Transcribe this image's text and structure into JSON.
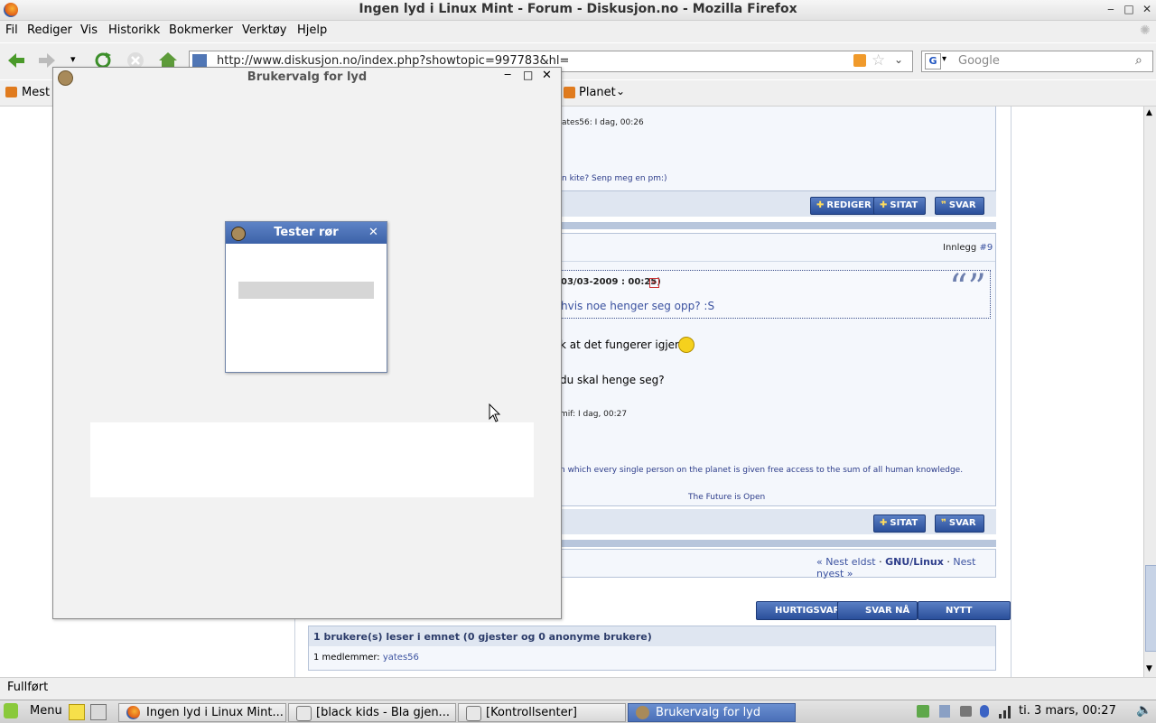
{
  "window": {
    "title": "Ingen lyd i Linux Mint - Forum - Diskusjon.no - Mozilla Firefox"
  },
  "menubar": [
    "Fil",
    "Rediger",
    "Vis",
    "Historikk",
    "Bokmerker",
    "Verktøy",
    "Hjelp"
  ],
  "navbar": {
    "url": "http://www.diskusjon.no/index.php?showtopic=997783&hl=",
    "search_placeholder": "Google"
  },
  "bookmarks": {
    "most_visited": "Mest",
    "planet": "Planet"
  },
  "forum": {
    "post1": {
      "meta": "ates56: I dag, 00:26",
      "signature": "n kite? Senp meg en pm:)"
    },
    "buttons": {
      "edit": "REDIGER",
      "quote": "SITAT",
      "reply": "SVAR"
    },
    "post2": {
      "post_label": "Innlegg",
      "post_number": "#9",
      "quote_header": "03/03-2009 : 00:25)",
      "quote_text": "hvis noe henger seg opp? :S",
      "line1": "k at det fungerer igjen...",
      "line2": "du skal henge seg?",
      "meta": "mif: I dag, 00:27",
      "signature1": "n which every single person on the planet is given free access to the sum of all human knowledge.",
      "signature2": "The Future is Open"
    },
    "nav": {
      "older": "« Nest eldst",
      "separator": "·",
      "forum": "GNU/Linux",
      "newer": "Nest nyest »"
    },
    "actions": {
      "quick_reply": "HURTIGSVAR",
      "reply_now": "SVAR NÅ",
      "new_topic": "NYTT EMNE"
    },
    "readers": {
      "title": "1 brukere(s) leser i emnet (0 gjester og 0 anonyme brukere)",
      "members_label": "1 medlemmer:",
      "member": "yates56"
    }
  },
  "status": "Fullført",
  "dialogs": {
    "main_title": "Brukervalg for lyd",
    "test_title": "Tester rør"
  },
  "taskbar": {
    "menu": "Menu",
    "tasks": [
      "Ingen lyd i Linux Mint...",
      "[black kids - Bla gjen...",
      "[Kontrollsenter]",
      "Brukervalg for lyd"
    ],
    "clock": "ti.  3 mars, 00:27"
  },
  "colors": {
    "forum_border": "#b6c3d8",
    "button": "#2a4f9a",
    "link": "#3b52a0",
    "taskbar_active": "#4a6fb8"
  }
}
